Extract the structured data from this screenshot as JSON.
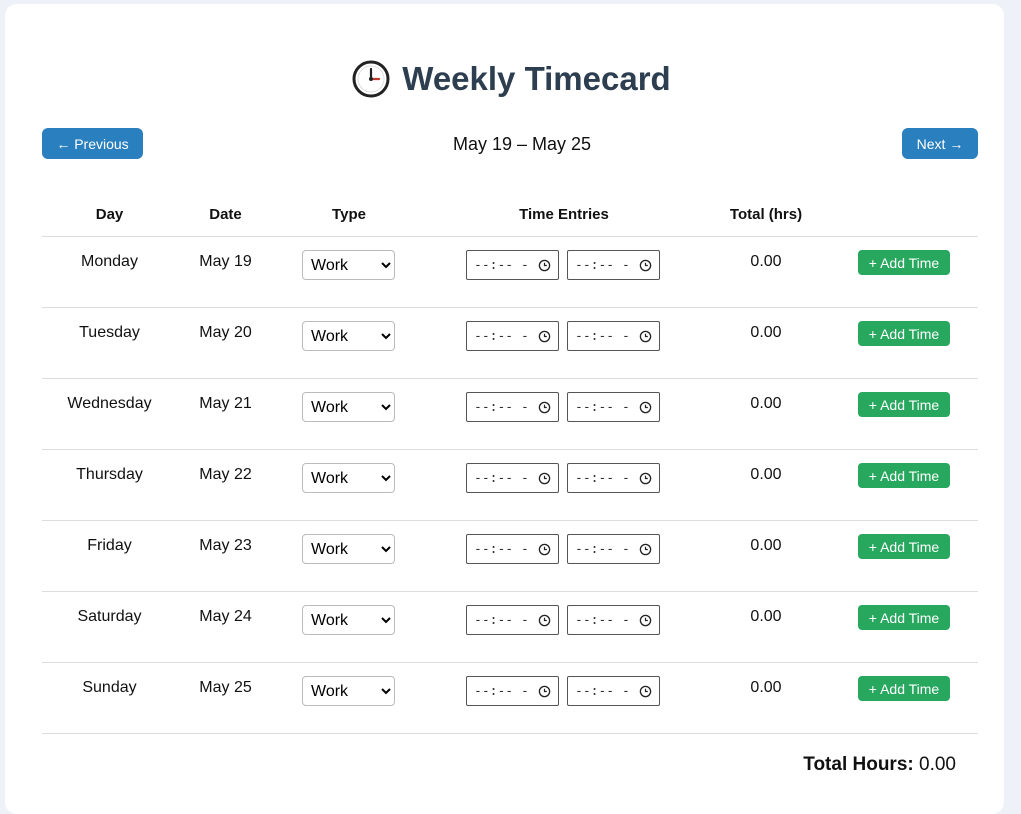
{
  "header": {
    "title": "Weekly Timecard",
    "icon": "clock-icon"
  },
  "nav": {
    "previous_label": "← Previous",
    "next_label": "Next →",
    "week_range": "May 19 – May 25"
  },
  "table": {
    "columns": [
      "Day",
      "Date",
      "Type",
      "Time Entries",
      "Total (hrs)",
      ""
    ],
    "type_options": [
      "Work"
    ],
    "time_placeholder": "--:-- -",
    "add_label": "+ Add Time",
    "rows": [
      {
        "day": "Monday",
        "date": "May 19",
        "type": "Work",
        "total": "0.00"
      },
      {
        "day": "Tuesday",
        "date": "May 20",
        "type": "Work",
        "total": "0.00"
      },
      {
        "day": "Wednesday",
        "date": "May 21",
        "type": "Work",
        "total": "0.00"
      },
      {
        "day": "Thursday",
        "date": "May 22",
        "type": "Work",
        "total": "0.00"
      },
      {
        "day": "Friday",
        "date": "May 23",
        "type": "Work",
        "total": "0.00"
      },
      {
        "day": "Saturday",
        "date": "May 24",
        "type": "Work",
        "total": "0.00"
      },
      {
        "day": "Sunday",
        "date": "May 25",
        "type": "Work",
        "total": "0.00"
      }
    ]
  },
  "summary": {
    "total_label": "Total Hours:",
    "total_value": "0.00"
  },
  "colors": {
    "title": "#2c3e50",
    "nav_button": "#2a7fbf",
    "add_button": "#28a85e",
    "background": "#eef1f8"
  }
}
